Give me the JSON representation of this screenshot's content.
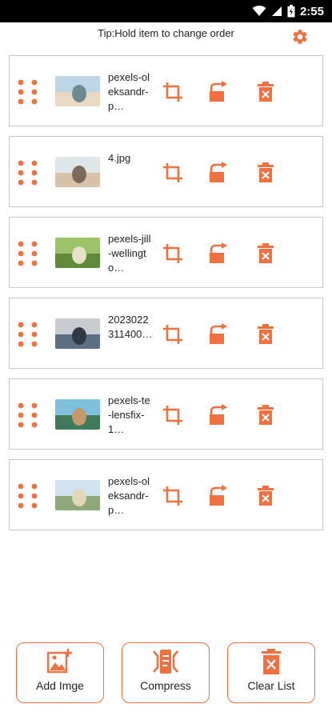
{
  "status_bar": {
    "time": "2:55"
  },
  "header": {
    "tip": "Tip:Hold item to change order"
  },
  "items": [
    {
      "name": "pexels-oleksandr-p…",
      "thumb_colors": [
        "#bcd6e8",
        "#e9d9c0",
        "#6d8a8f"
      ]
    },
    {
      "name": "4.jpg",
      "thumb_colors": [
        "#dfe6ea",
        "#d9c3a8",
        "#7a6a5a"
      ]
    },
    {
      "name": "pexels-jill-wellingto…",
      "thumb_colors": [
        "#9cc36a",
        "#5f8a3a",
        "#e8e0c8"
      ]
    },
    {
      "name": "2023022311400…",
      "thumb_colors": [
        "#c8ccd0",
        "#5c6f84",
        "#2f3a45"
      ]
    },
    {
      "name": "pexels-te-lensfix-1…",
      "thumb_colors": [
        "#7ec0de",
        "#3f7a5a",
        "#c49a6c"
      ]
    },
    {
      "name": "pexels-oleksandr-p…",
      "thumb_colors": [
        "#cfe2ef",
        "#8fa87a",
        "#e3d6b8"
      ]
    }
  ],
  "actions": {
    "add_label": "Add Imge",
    "compress_label": "Compress",
    "clear_label": "Clear List"
  },
  "colors": {
    "accent": "#f07040",
    "border": "#c8c8c8"
  }
}
